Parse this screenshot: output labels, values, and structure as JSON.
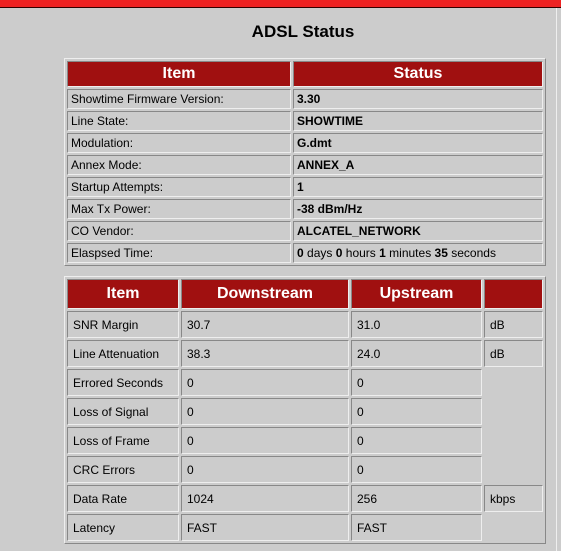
{
  "title": "ADSL Status",
  "status_table": {
    "headers": [
      "Item",
      "Status"
    ],
    "rows": [
      {
        "label": "Showtime Firmware Version:",
        "value": "3.30"
      },
      {
        "label": "Line State:",
        "value": "SHOWTIME"
      },
      {
        "label": "Modulation:",
        "value": "G.dmt"
      },
      {
        "label": "Annex Mode:",
        "value": "ANNEX_A"
      },
      {
        "label": "Startup Attempts:",
        "value": "1"
      },
      {
        "label": "Max Tx Power:",
        "value": "-38 dBm/Hz"
      },
      {
        "label": "CO Vendor:",
        "value": "ALCATEL_NETWORK"
      }
    ],
    "elapsed": {
      "label": "Elaspsed Time:",
      "days": "0",
      "days_unit": "days",
      "hours": "0",
      "hours_unit": "hours",
      "minutes": "1",
      "minutes_unit": "minutes",
      "seconds": "35",
      "seconds_unit": "seconds"
    }
  },
  "stats_table": {
    "headers": [
      "Item",
      "Downstream",
      "Upstream",
      ""
    ],
    "rows": [
      {
        "label": "SNR Margin",
        "down": "30.7",
        "up": "31.0",
        "unit": "dB"
      },
      {
        "label": "Line Attenuation",
        "down": "38.3",
        "up": "24.0",
        "unit": "dB"
      },
      {
        "label": "Errored Seconds",
        "down": "0",
        "up": "0",
        "unit": ""
      },
      {
        "label": "Loss of Signal",
        "down": "0",
        "up": "0",
        "unit": ""
      },
      {
        "label": "Loss of Frame",
        "down": "0",
        "up": "0",
        "unit": ""
      },
      {
        "label": "CRC Errors",
        "down": "0",
        "up": "0",
        "unit": ""
      },
      {
        "label": "Data Rate",
        "down": "1024",
        "up": "256",
        "unit": "kbps"
      },
      {
        "label": "Latency",
        "down": "FAST",
        "up": "FAST",
        "unit": ""
      }
    ]
  }
}
